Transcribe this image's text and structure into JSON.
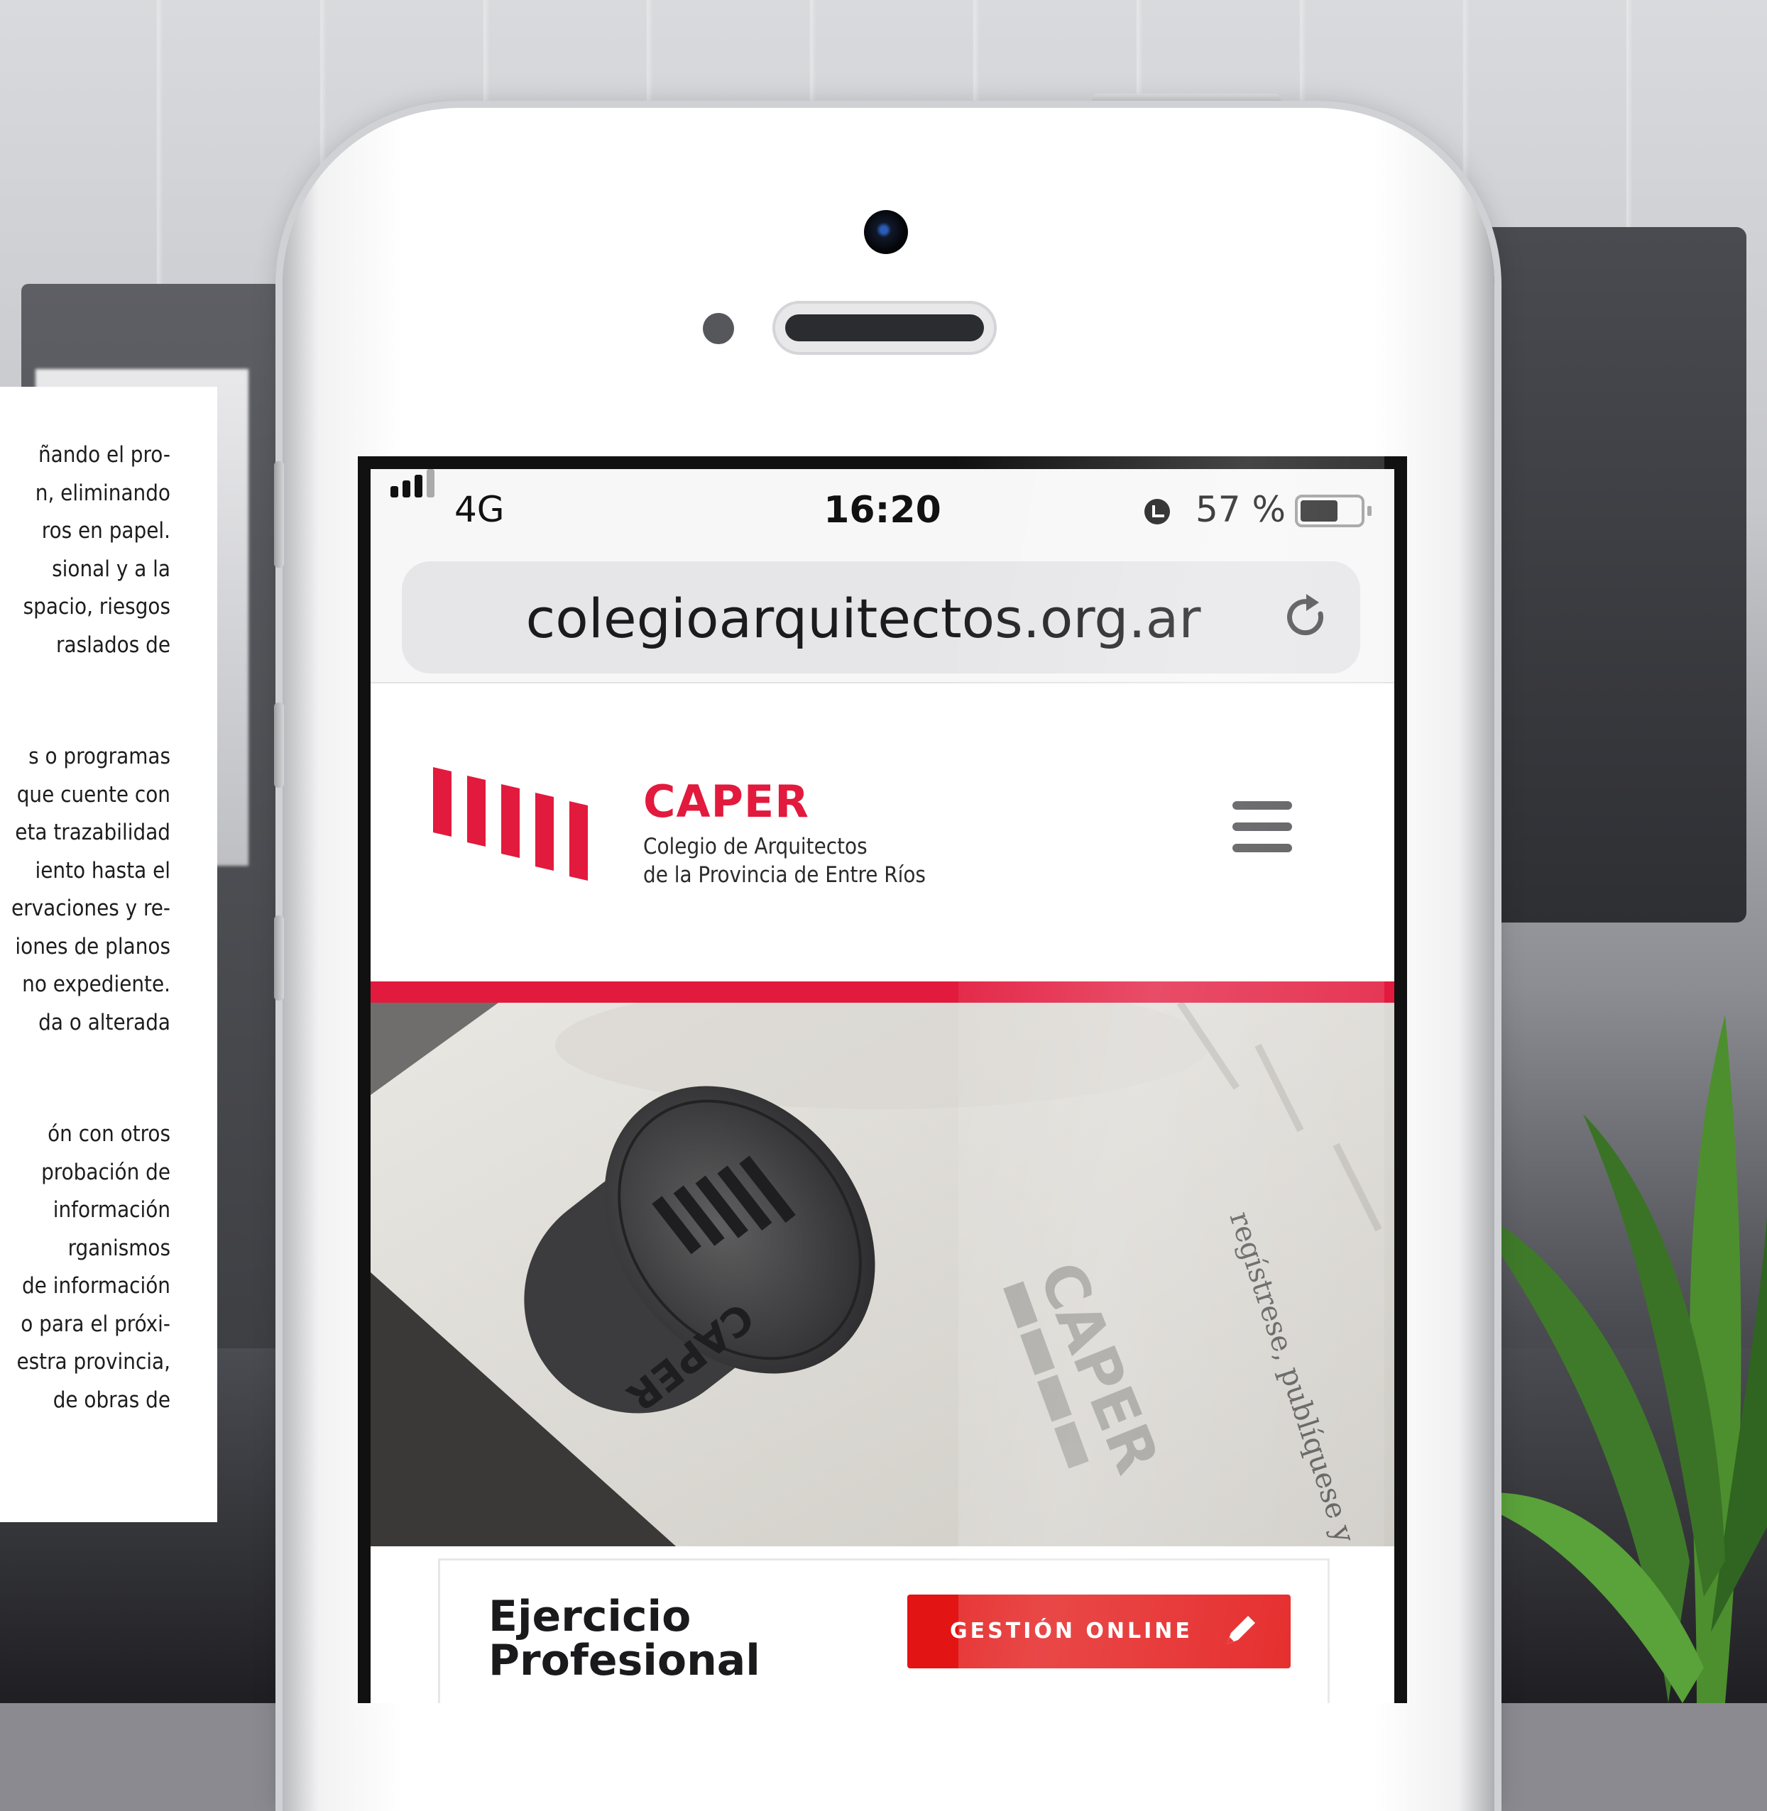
{
  "left_card": {
    "paragraphs": [
      [
        "ñando el pro-",
        "n, eliminando",
        "ros en papel.",
        "sional y a la",
        "spacio, riesgos",
        "raslados de"
      ],
      [
        "s o programas",
        "que cuente con",
        "eta trazabilidad",
        "iento hasta el",
        "ervaciones y re-",
        "iones de planos",
        "no expediente.",
        "da o alterada"
      ],
      [
        "ón con otros",
        "probación de",
        "información",
        "rganismos",
        "de información",
        "o para el próxi-",
        "estra provincia,",
        "de obras de"
      ]
    ]
  },
  "status_bar": {
    "carrier": "4G",
    "time": "16:20",
    "battery": "57 %",
    "icons": [
      "signal-icon",
      "alarm-icon",
      "battery-icon"
    ]
  },
  "browser": {
    "url": "colegioarquitectos.org.ar",
    "reload_icon": "reload-icon"
  },
  "site": {
    "brand_name": "CAPER",
    "brand_sub_1": "Colegio de Arquitectos",
    "brand_sub_2": "de la Provincia de Entre Ríos",
    "menu_icon": "hamburger-menu-icon",
    "accent_color": "#e21a3d",
    "hero": {
      "stamp_text": "CAPER",
      "paper_text": "regístrese, publíquese y a"
    },
    "card": {
      "title_line_1": "Ejercicio",
      "title_line_2": "Profesional",
      "button_label": "GESTIÓN ONLINE",
      "button_color": "#e31414",
      "button_icon": "pencil-icon"
    }
  }
}
